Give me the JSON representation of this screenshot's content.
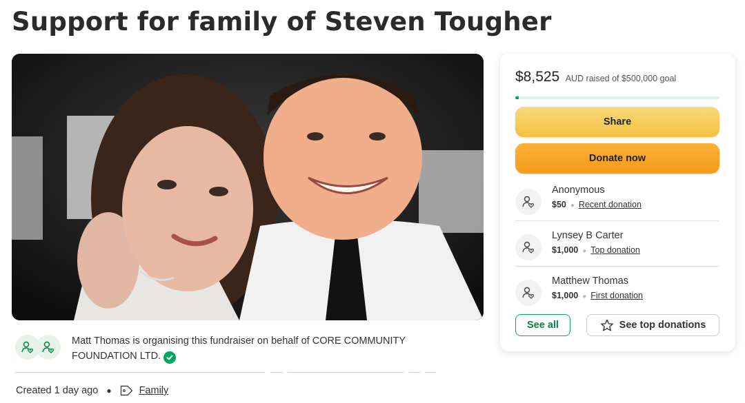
{
  "page": {
    "title": "Support for family of Steven Tougher"
  },
  "organiser": {
    "text": "Matt Thomas is organising this fundraiser on behalf of CORE COMMUNITY FOUNDATION LTD."
  },
  "meta": {
    "created": "Created 1 day ago",
    "category": "Family"
  },
  "donation_card": {
    "amount_raised": "$8,525",
    "goal_text": "AUD raised of $500,000 goal",
    "progress_fraction": 0.017,
    "share_label": "Share",
    "donate_label": "Donate now",
    "donors": [
      {
        "name": "Anonymous",
        "amount": "$50",
        "tag": "Recent donation"
      },
      {
        "name": "Lynsey B Carter",
        "amount": "$1,000",
        "tag": "Top donation"
      },
      {
        "name": "Matthew Thomas",
        "amount": "$1,000",
        "tag": "First donation"
      }
    ],
    "see_all_label": "See all",
    "see_top_label": "See top donations"
  },
  "colors": {
    "brand_green": "#02a95c",
    "share_yellow": "#f2c143",
    "donate_orange": "#f49a19"
  }
}
